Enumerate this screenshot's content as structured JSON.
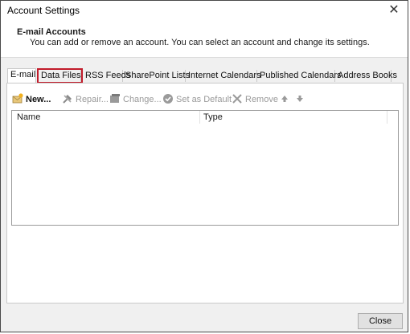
{
  "window": {
    "title": "Account Settings"
  },
  "header": {
    "title": "E-mail Accounts",
    "description": "You can add or remove an account. You can select an account and change its settings."
  },
  "tabs": [
    {
      "label": "E-mail",
      "active": true
    },
    {
      "label": "Data Files",
      "highlighted": true
    },
    {
      "label": "RSS Feeds"
    },
    {
      "label": "SharePoint Lists"
    },
    {
      "label": "Internet Calendars"
    },
    {
      "label": "Published Calendars"
    },
    {
      "label": "Address Books"
    }
  ],
  "toolbar": {
    "new": "New...",
    "repair": "Repair...",
    "change": "Change...",
    "set_default": "Set as Default",
    "remove": "Remove"
  },
  "list": {
    "columns": [
      "Name",
      "Type"
    ]
  },
  "footer": {
    "close": "Close"
  },
  "colors": {
    "highlight_box": "#c11b2a"
  }
}
